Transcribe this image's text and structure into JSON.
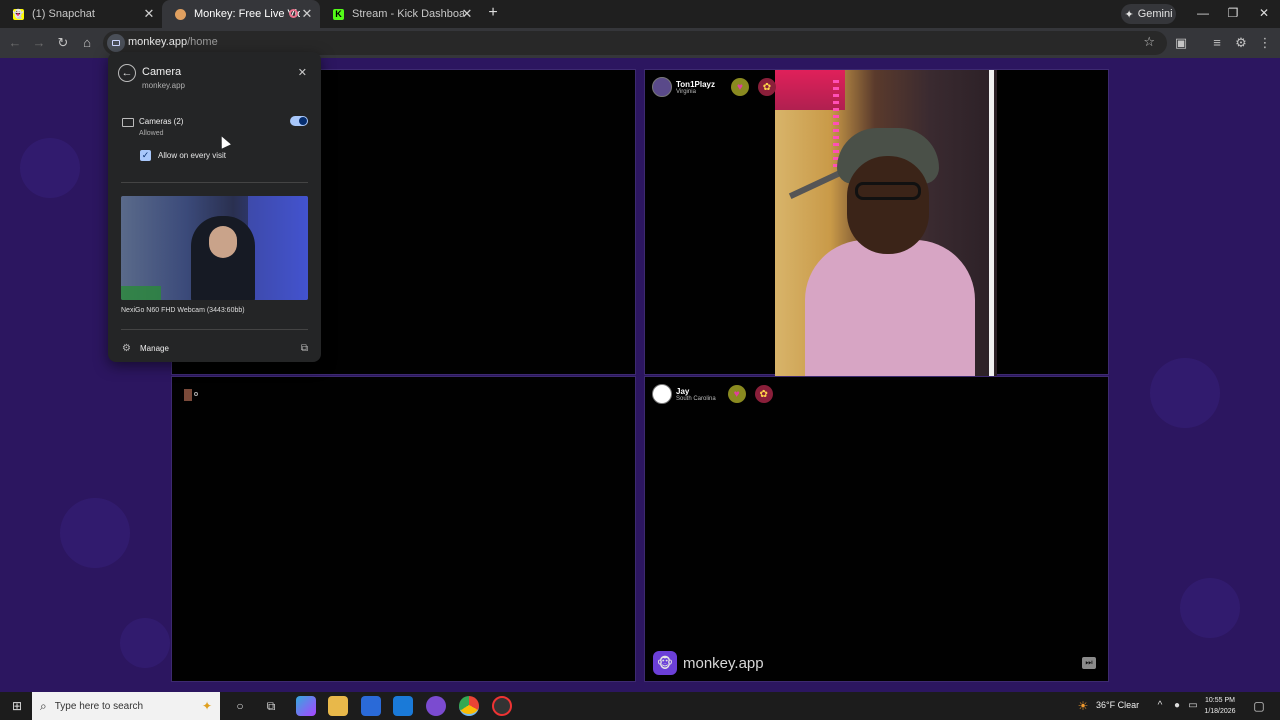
{
  "browser": {
    "tabs": [
      {
        "title": "(1) Snapchat",
        "icon": "snapchat-icon",
        "active": false
      },
      {
        "title": "Monkey: Free Live Video Ch",
        "icon": "monkey-icon",
        "active": true
      },
      {
        "title": "Stream - Kick Dashboard",
        "icon": "kick-icon",
        "active": false
      }
    ],
    "gemini_label": "Gemini",
    "url_host": "monkey.app",
    "url_path": "/home"
  },
  "tiles": {
    "top_right": {
      "name": "Ton1Playz",
      "location": "Virginia"
    },
    "bottom_right": {
      "name": "Jay",
      "location": "South Carolina"
    },
    "brand": "monkey.app"
  },
  "camera_popup": {
    "title": "Camera",
    "site": "monkey.app",
    "cameras_label": "Cameras (2)",
    "cameras_state": "Allowed",
    "toggle_on": true,
    "checkbox_label": "Allow on every visit",
    "checkbox_checked": true,
    "device_name": "NexiGo N60 FHD Webcam (3443:60bb)",
    "manage_label": "Manage"
  },
  "taskbar": {
    "search_placeholder": "Type here to search",
    "weather": "36°F Clear",
    "time": "10:55 PM",
    "date": "1/18/2026"
  },
  "colors": {
    "page_bg": "#2c1660",
    "tile_bg": "#010101",
    "accent": "#a8c7fa"
  }
}
